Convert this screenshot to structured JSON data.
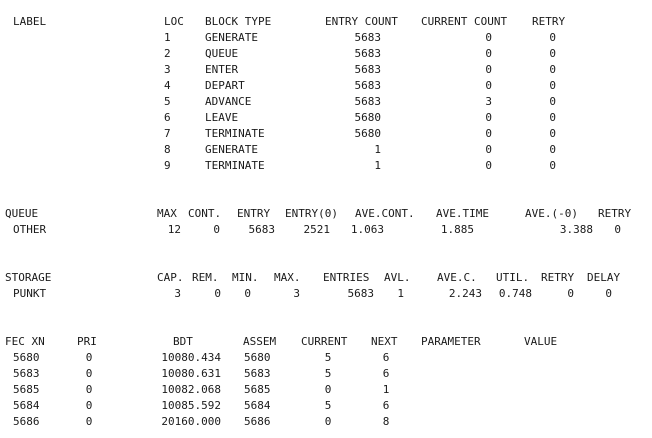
{
  "blocks": {
    "headers": [
      "LABEL",
      "LOC",
      "BLOCK TYPE",
      "ENTRY COUNT",
      "CURRENT COUNT",
      "RETRY"
    ],
    "rows": [
      {
        "loc": "1",
        "type": "GENERATE",
        "entry": "5683",
        "current": "0",
        "retry": "0"
      },
      {
        "loc": "2",
        "type": "QUEUE",
        "entry": "5683",
        "current": "0",
        "retry": "0"
      },
      {
        "loc": "3",
        "type": "ENTER",
        "entry": "5683",
        "current": "0",
        "retry": "0"
      },
      {
        "loc": "4",
        "type": "DEPART",
        "entry": "5683",
        "current": "0",
        "retry": "0"
      },
      {
        "loc": "5",
        "type": "ADVANCE",
        "entry": "5683",
        "current": "3",
        "retry": "0"
      },
      {
        "loc": "6",
        "type": "LEAVE",
        "entry": "5680",
        "current": "0",
        "retry": "0"
      },
      {
        "loc": "7",
        "type": "TERMINATE",
        "entry": "5680",
        "current": "0",
        "retry": "0"
      },
      {
        "loc": "8",
        "type": "GENERATE",
        "entry": "1",
        "current": "0",
        "retry": "0"
      },
      {
        "loc": "9",
        "type": "TERMINATE",
        "entry": "1",
        "current": "0",
        "retry": "0"
      }
    ]
  },
  "queue": {
    "headers": [
      "QUEUE",
      "MAX",
      "CONT.",
      "ENTRY",
      "ENTRY(0)",
      "AVE.CONT.",
      "AVE.TIME",
      "AVE.(-0)",
      "RETRY"
    ],
    "row": {
      "name": "OTHER",
      "max": "12",
      "cont": "0",
      "entry": "5683",
      "entry0": "2521",
      "avecont": "1.063",
      "avetime": "1.885",
      "ave0": "3.388",
      "retry": "0"
    }
  },
  "storage": {
    "headers": [
      "STORAGE",
      "CAP.",
      "REM.",
      "MIN.",
      "MAX.",
      "ENTRIES",
      "AVL.",
      "AVE.C.",
      "UTIL.",
      "RETRY",
      "DELAY"
    ],
    "row": {
      "name": "PUNKT",
      "cap": "3",
      "rem": "0",
      "min": "0",
      "max": "3",
      "entries": "5683",
      "avl": "1",
      "avec": "2.243",
      "util": "0.748",
      "retry": "0",
      "delay": "0"
    }
  },
  "fec": {
    "headers": [
      "FEC XN",
      "PRI",
      "BDT",
      "ASSEM",
      "CURRENT",
      "NEXT",
      "PARAMETER",
      "VALUE"
    ],
    "rows": [
      {
        "xn": "5680",
        "pri": "0",
        "bdt": "10080.434",
        "assem": "5680",
        "current": "5",
        "next": "6"
      },
      {
        "xn": "5683",
        "pri": "0",
        "bdt": "10080.631",
        "assem": "5683",
        "current": "5",
        "next": "6"
      },
      {
        "xn": "5685",
        "pri": "0",
        "bdt": "10082.068",
        "assem": "5685",
        "current": "0",
        "next": "1"
      },
      {
        "xn": "5684",
        "pri": "0",
        "bdt": "10085.592",
        "assem": "5684",
        "current": "5",
        "next": "6"
      },
      {
        "xn": "5686",
        "pri": "0",
        "bdt": "20160.000",
        "assem": "5686",
        "current": "0",
        "next": "8"
      }
    ]
  }
}
